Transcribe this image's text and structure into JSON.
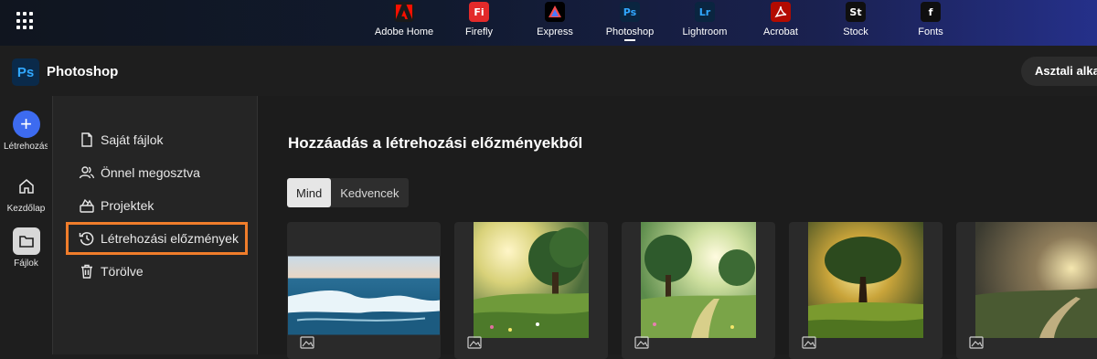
{
  "topbar": {
    "apps": [
      {
        "label": "Adobe Home",
        "glyph": "",
        "color": "#fa0f00",
        "bg": "#1a1a1a",
        "icon": "adobe-home-icon"
      },
      {
        "label": "Firefly",
        "glyph": "Fi",
        "color": "#ffffff",
        "bg": "#e32a2a",
        "icon": "firefly-icon"
      },
      {
        "label": "Express",
        "glyph": "",
        "color": "#ffffff",
        "bg": "#000000",
        "icon": "express-icon"
      },
      {
        "label": "Photoshop",
        "glyph": "Ps",
        "color": "#31a8ff",
        "bg": "#0a2540",
        "icon": "photoshop-icon",
        "active": true
      },
      {
        "label": "Lightroom",
        "glyph": "Lr",
        "color": "#31a8ff",
        "bg": "#0a2540",
        "icon": "lightroom-icon"
      },
      {
        "label": "Acrobat",
        "glyph": "",
        "color": "#ffffff",
        "bg": "#b30b00",
        "icon": "acrobat-icon"
      },
      {
        "label": "Stock",
        "glyph": "St",
        "color": "#ffffff",
        "bg": "#0f0f0f",
        "icon": "stock-icon"
      },
      {
        "label": "Fonts",
        "glyph": "f",
        "color": "#ffffff",
        "bg": "#0f0f0f",
        "icon": "fonts-icon"
      }
    ]
  },
  "header": {
    "logo": "Ps",
    "title": "Photoshop",
    "desktop_button": "Asztali alkalmazás"
  },
  "rail": {
    "create": "Létrehozás",
    "home": "Kezdőlap",
    "files": "Fájlok"
  },
  "panel": {
    "items": [
      {
        "label": "Saját fájlok",
        "icon": "file-icon"
      },
      {
        "label": "Önnel megosztva",
        "icon": "shared-users-icon"
      },
      {
        "label": "Projektek",
        "icon": "projects-icon"
      },
      {
        "label": "Létrehozási előzmények",
        "icon": "history-icon",
        "selected": true
      },
      {
        "label": "Törölve",
        "icon": "trash-icon"
      }
    ]
  },
  "main": {
    "title": "Hozzáadás a létrehozási előzményekből",
    "tabs": [
      {
        "label": "Mind",
        "active": true
      },
      {
        "label": "Kedvencek",
        "active": false
      }
    ]
  },
  "colors": {
    "accent": "#3d6bf0",
    "highlight": "#f07d2b"
  }
}
